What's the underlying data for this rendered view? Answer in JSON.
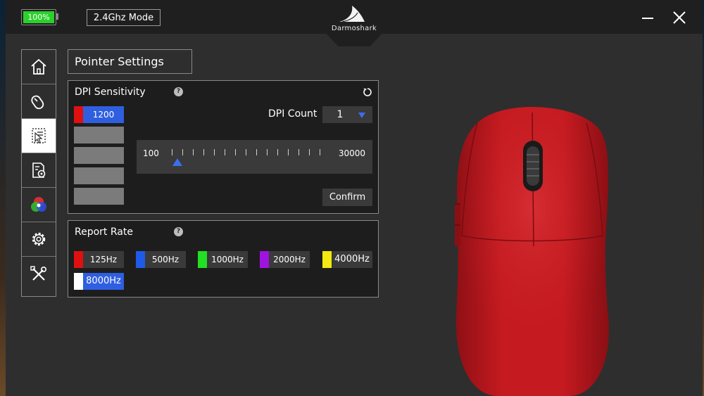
{
  "window": {
    "battery": {
      "text": "100%",
      "level": 1.0,
      "color": "#2bd12b"
    },
    "mode": "2.4Ghz Mode",
    "brand": "Darmoshark"
  },
  "sidebar": {
    "items": [
      {
        "id": "home",
        "icon": "home-icon",
        "active": false
      },
      {
        "id": "mouse",
        "icon": "mouse-icon",
        "active": false
      },
      {
        "id": "pointer",
        "icon": "pointer-settings-icon",
        "active": true
      },
      {
        "id": "macro",
        "icon": "document-gear-icon",
        "active": false
      },
      {
        "id": "lighting",
        "icon": "rgb-circles-icon",
        "active": false
      },
      {
        "id": "settings",
        "icon": "gear-icon",
        "active": false
      },
      {
        "id": "tools",
        "icon": "wrench-screwdriver-icon",
        "active": false
      }
    ]
  },
  "page": {
    "title": "Pointer Settings"
  },
  "dpi": {
    "title": "DPI Sensitivity",
    "help": "?",
    "slots": [
      {
        "value": "1200",
        "color": "#e01010",
        "active": true
      },
      {
        "value": "",
        "color": "",
        "active": false
      },
      {
        "value": "",
        "color": "",
        "active": false
      },
      {
        "value": "",
        "color": "",
        "active": false
      },
      {
        "value": "",
        "color": "",
        "active": false
      }
    ],
    "count_label": "DPI Count",
    "count_value": "1",
    "slider": {
      "min_label": "100",
      "max_label": "30000",
      "min": 100,
      "max": 30000,
      "value": 1200,
      "tick_count": 15
    },
    "confirm_label": "Confirm"
  },
  "report_rate": {
    "title": "Report Rate",
    "help": "?",
    "options": [
      {
        "label": "125Hz",
        "color": "#e01010",
        "active": false
      },
      {
        "label": "500Hz",
        "color": "#1f5be8",
        "active": false
      },
      {
        "label": "1000Hz",
        "color": "#22e022",
        "active": false
      },
      {
        "label": "2000Hz",
        "color": "#a012e0",
        "active": false
      },
      {
        "label": "4000Hz",
        "color": "#f2ea10",
        "active": false
      },
      {
        "label": "8000Hz",
        "color": "#ffffff",
        "active": true
      }
    ]
  },
  "colors": {
    "accent": "#2f5fe0",
    "mouse_body": "#c4171d"
  }
}
